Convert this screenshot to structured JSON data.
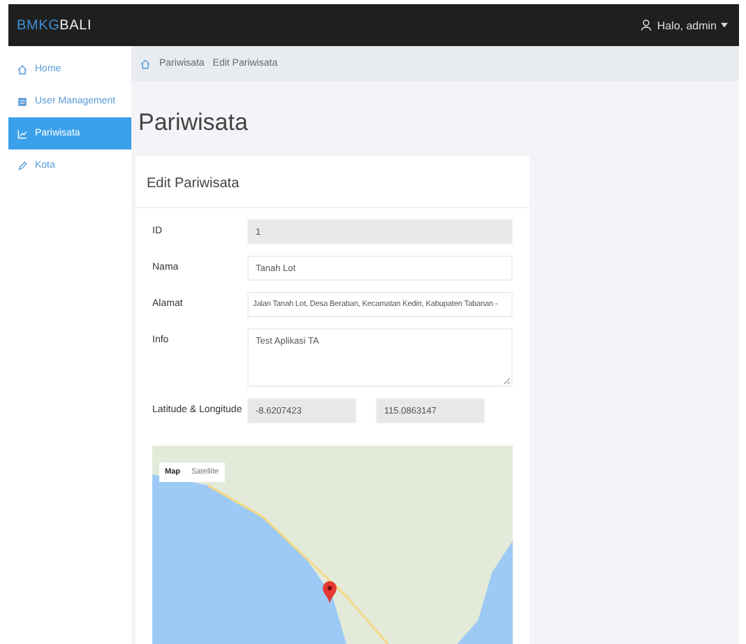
{
  "navbar": {
    "brand_prefix": "BMKG",
    "brand_suffix": "BALI",
    "user_menu": "Halo, admin"
  },
  "sidebar": {
    "items": [
      {
        "label": "Home",
        "kind": "home",
        "selected": false
      },
      {
        "label": "User Management",
        "kind": "user",
        "selected": false
      },
      {
        "label": "Pariwisata",
        "kind": "chart",
        "selected": true
      },
      {
        "label": "Kota",
        "kind": "pencil",
        "selected": false
      }
    ]
  },
  "breadcrumb": [
    "Pariwisata",
    "Edit Pariwisata"
  ],
  "page_title": "Pariwisata",
  "card": {
    "title": "Edit Pariwisata",
    "fields": [
      {
        "label": "ID",
        "kind": "input",
        "values": [
          "1"
        ],
        "disabled": true
      },
      {
        "label": "Nama",
        "kind": "input",
        "values": [
          "Tanah Lot"
        ],
        "disabled": false
      },
      {
        "label": "Alamat",
        "kind": "input",
        "values": [
          "Jalan Tanah Lot, Desa Beraban, Kecamatan Kediri, Kabupaten Tabanan -"
        ],
        "disabled": false
      },
      {
        "label": "Info",
        "kind": "textarea",
        "values": [
          "Test Aplikasi TA"
        ],
        "disabled": false
      },
      {
        "label": "Latitude & Longitude",
        "kind": "pair",
        "values": [
          "-8.6207423",
          "115.0863147"
        ],
        "disabled": true
      }
    ],
    "map": {
      "map_types": [
        {
          "label": "Map",
          "selected": true
        },
        {
          "label": "Satellite",
          "selected": false
        }
      ]
    }
  }
}
